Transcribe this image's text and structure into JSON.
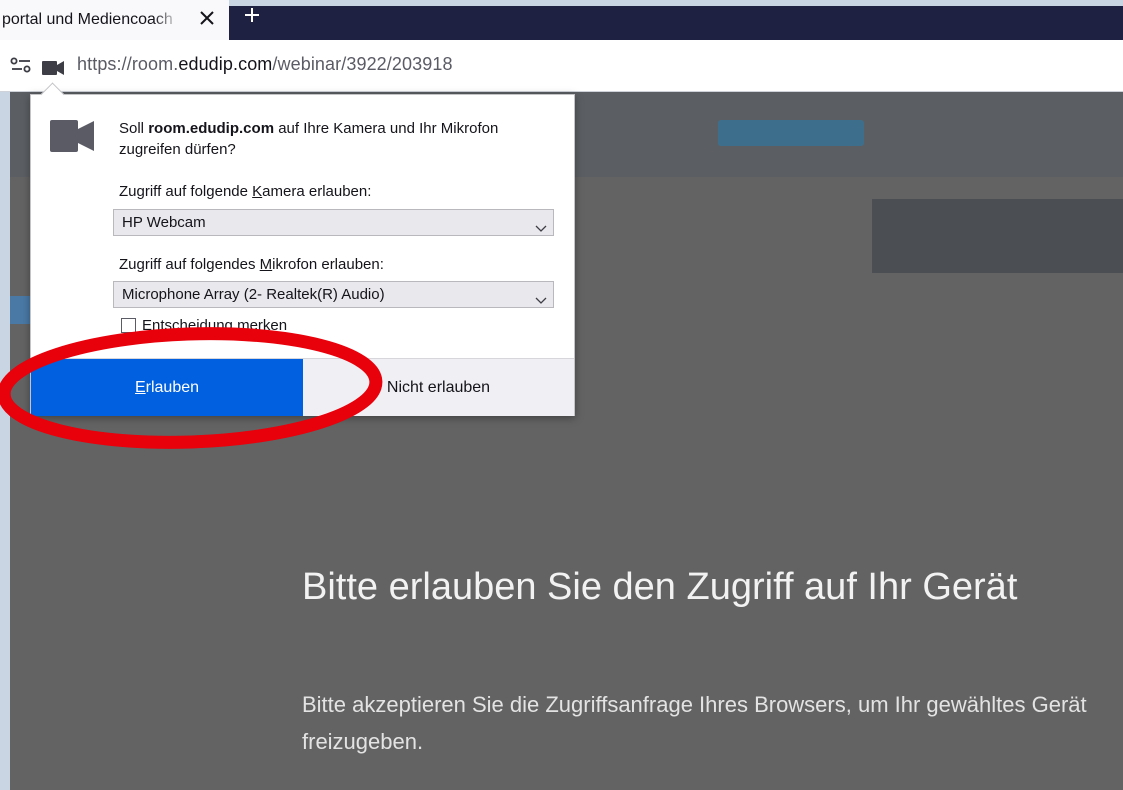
{
  "tab": {
    "title": "portal und Mediencoach"
  },
  "urlbar": {
    "scheme": "https://room.",
    "host": "edudip.com",
    "path": "/webinar/3922/203918"
  },
  "popup": {
    "message_pre": "Soll ",
    "message_host": "room.edudip.com",
    "message_post": " auf Ihre Kamera und Ihr Mikrofon zugreifen dürfen?",
    "camera_label_pre": "Zugriff auf folgende ",
    "camera_label_key": "K",
    "camera_label_post": "amera erlauben:",
    "camera_selected": "HP Webcam",
    "mic_label_pre": "Zugriff auf folgendes ",
    "mic_label_key": "M",
    "mic_label_post": "ikrofon erlauben:",
    "mic_selected": "Microphone Array (2- Realtek(R) Audio)",
    "remember_label": "Entscheidung merken",
    "allow_key": "E",
    "allow_rest": "rlauben",
    "deny_label": "Nicht erlauben"
  },
  "page": {
    "headline": "Bitte erlauben Sie den Zugriff auf Ihr Gerät",
    "subline": "Bitte akzeptieren Sie die Zugriffsanfrage Ihres Browsers, um Ihr gewähltes Gerät freizugeben."
  },
  "colors": {
    "accent": "#0060df",
    "annotation": "#e8000b",
    "tabbar_dark": "#1f2142",
    "overlay": "#636363"
  },
  "icons": [
    "close-icon",
    "plus-icon",
    "permissions-icon",
    "camera-icon",
    "chevron-down-icon"
  ]
}
